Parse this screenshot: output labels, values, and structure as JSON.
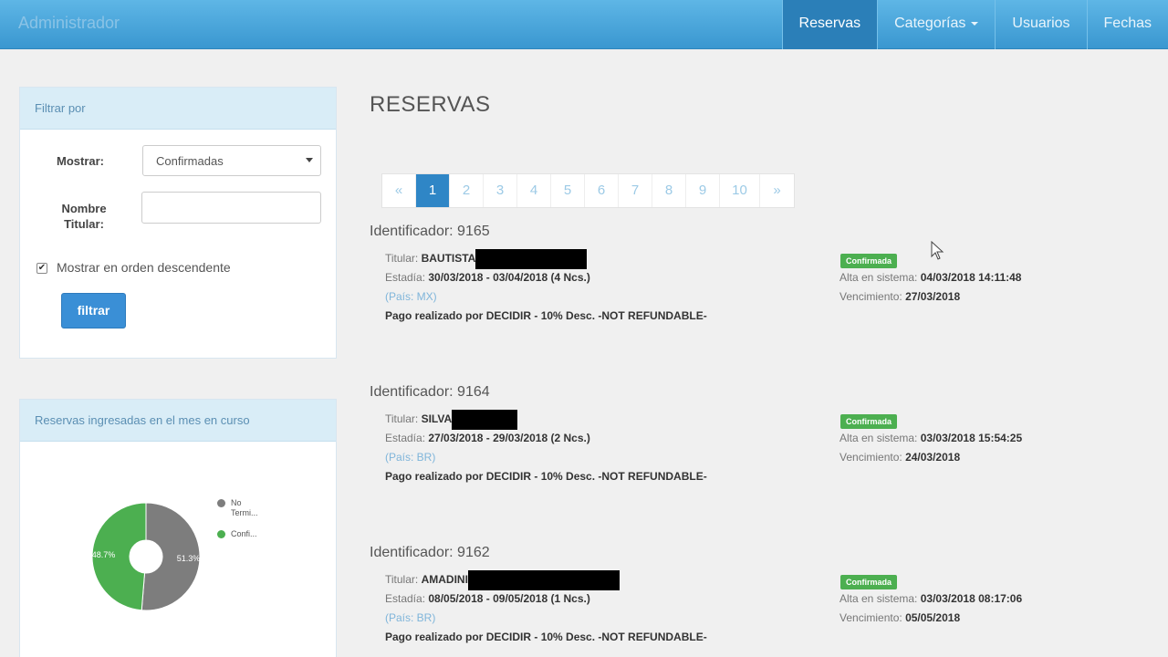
{
  "app": {
    "brand": "Administrador"
  },
  "nav": {
    "reservas": "Reservas",
    "categorias": "Categorías",
    "usuarios": "Usuarios",
    "fechas": "Fechas"
  },
  "filter": {
    "heading": "Filtrar por",
    "mostrar_label": "Mostrar:",
    "mostrar_value": "Confirmadas",
    "nombre_label": "Nombre Titular:",
    "nombre_value": "",
    "checkbox_label": "Mostrar en orden descendente",
    "checkbox_checked": true,
    "button": "filtrar"
  },
  "chart_panel": {
    "heading": "Reservas ingresadas en el mes en curso"
  },
  "chart_data": {
    "type": "pie",
    "series": [
      {
        "name": "No Termi...",
        "value": 51.3,
        "label": "51.3%",
        "color": "#7d7d7d"
      },
      {
        "name": "Confi...",
        "value": 48.7,
        "label": "48.7%",
        "color": "#4caf50"
      }
    ]
  },
  "main": {
    "title": "RESERVAS",
    "pages": [
      "«",
      "1",
      "2",
      "3",
      "4",
      "5",
      "6",
      "7",
      "8",
      "9",
      "10",
      "»"
    ],
    "active_page": "1"
  },
  "reservas": [
    {
      "id_label": "Identificador: 9165",
      "titular_label": "Titular:",
      "titular_value": "BAUTISTA",
      "estadia_label": "Estadía:",
      "estadia_value": "30/03/2018 - 03/04/2018 (4 Ncs.)",
      "pais": "(País: MX)",
      "pago": "Pago realizado por DECIDIR - 10% Desc. -NOT REFUNDABLE-",
      "status": "Confirmada",
      "alta_label": "Alta en sistema:",
      "alta_value": "04/03/2018 14:11:48",
      "venc_label": "Vencimiento:",
      "venc_value": "27/03/2018"
    },
    {
      "id_label": "Identificador: 9164",
      "titular_label": "Titular:",
      "titular_value": "SILVA",
      "estadia_label": "Estadía:",
      "estadia_value": "27/03/2018 - 29/03/2018 (2 Ncs.)",
      "pais": "(País: BR)",
      "pago": "Pago realizado por DECIDIR - 10% Desc. -NOT REFUNDABLE-",
      "status": "Confirmada",
      "alta_label": "Alta en sistema:",
      "alta_value": "03/03/2018 15:54:25",
      "venc_label": "Vencimiento:",
      "venc_value": "24/03/2018"
    },
    {
      "id_label": "Identificador: 9162",
      "titular_label": "Titular:",
      "titular_value": "AMADINI",
      "estadia_label": "Estadía:",
      "estadia_value": "08/05/2018 - 09/05/2018 (1 Ncs.)",
      "pais": "(País: BR)",
      "pago": "Pago realizado por DECIDIR - 10% Desc. -NOT REFUNDABLE-",
      "status": "Confirmada",
      "alta_label": "Alta en sistema:",
      "alta_value": "03/03/2018 08:17:06",
      "venc_label": "Vencimiento:",
      "venc_value": "05/05/2018"
    }
  ]
}
